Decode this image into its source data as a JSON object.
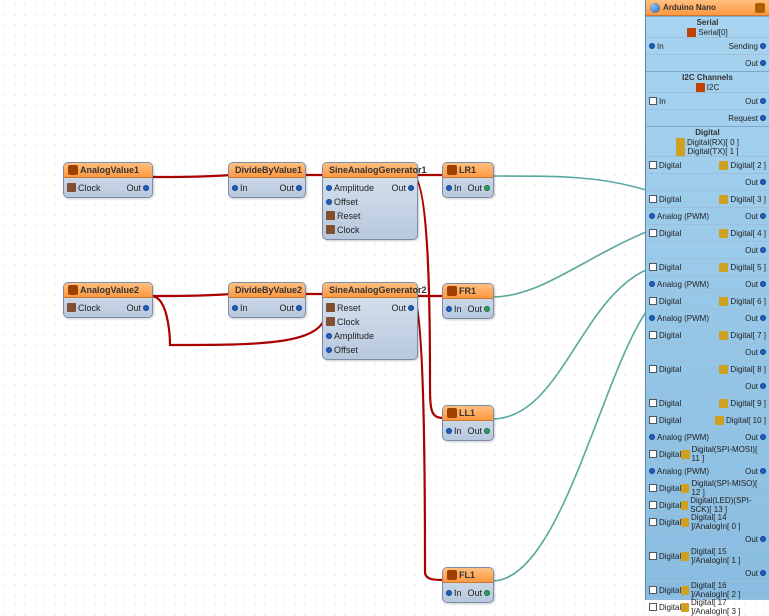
{
  "nodes": {
    "av1": {
      "title": "AnalogValue1",
      "p_clock": "Clock",
      "p_out": "Out"
    },
    "av2": {
      "title": "AnalogValue2",
      "p_clock": "Clock",
      "p_out": "Out"
    },
    "dv1": {
      "title": "DivideByValue1",
      "p_in": "In",
      "p_out": "Out"
    },
    "dv2": {
      "title": "DivideByValue2",
      "p_in": "In",
      "p_out": "Out"
    },
    "sg1": {
      "title": "SineAnalogGenerator1",
      "p_amp": "Amplitude",
      "p_off": "Offset",
      "p_rst": "Reset",
      "p_clk": "Clock",
      "p_out": "Out"
    },
    "sg2": {
      "title": "SineAnalogGenerator2",
      "p_rst": "Reset",
      "p_clk": "Clock",
      "p_amp": "Amplitude",
      "p_off": "Offset",
      "p_out": "Out"
    },
    "lr1": {
      "title": "LR1",
      "p_in": "In",
      "p_out": "Out"
    },
    "fr1": {
      "title": "FR1",
      "p_in": "In",
      "p_out": "Out"
    },
    "ll1": {
      "title": "LL1",
      "p_in": "In",
      "p_out": "Out"
    },
    "fl1": {
      "title": "FL1",
      "p_in": "In",
      "p_out": "Out"
    }
  },
  "arduino": {
    "title": "Arduino Nano",
    "sec_serial": "Serial",
    "serial0": "Serial[0]",
    "lbl_in": "In",
    "lbl_sending": "Sending",
    "lbl_out": "Out",
    "sec_i2c": "I2C Channels",
    "i2c": "I2C",
    "lbl_req": "Request",
    "sec_digital": "Digital",
    "rx": "Digital(RX)[ 0 ]",
    "tx": "Digital(TX)[ 1 ]",
    "d2": "Digital[ 2 ]",
    "d3": "Digital[ 3 ]",
    "aw3": "Analog (PWM)",
    "d4": "Digital[ 4 ]",
    "d5": "Digital[ 5 ]",
    "aw5": "Analog (PWM)",
    "d6": "Digital[ 6 ]",
    "aw6": "Analog (PWM)",
    "d7": "Digital[ 7 ]",
    "d8": "Digital[ 8 ]",
    "d9": "Digital[ 9 ]",
    "d10": "Digital[ 10 ]",
    "aw10": "Analog (PWM)",
    "d11": "Digital(SPI-MOSI)[ 11 ]",
    "aw11": "Analog (PWM)",
    "d12": "Digital(SPI-MISO)[ 12 ]",
    "d13": "Digital(LED)(SPI-SCK)[ 13 ]",
    "d14": "Digital[ 14 ]/AnalogIn[ 0 ]",
    "d15": "Digital[ 15 ]/AnalogIn[ 1 ]",
    "d16": "Digital[ 16 ]/AnalogIn[ 2 ]",
    "d17": "Digital[ 17 ]/AnalogIn[ 3 ]",
    "lbl_digital": "Digital",
    "lbl_analog": "Analog"
  }
}
